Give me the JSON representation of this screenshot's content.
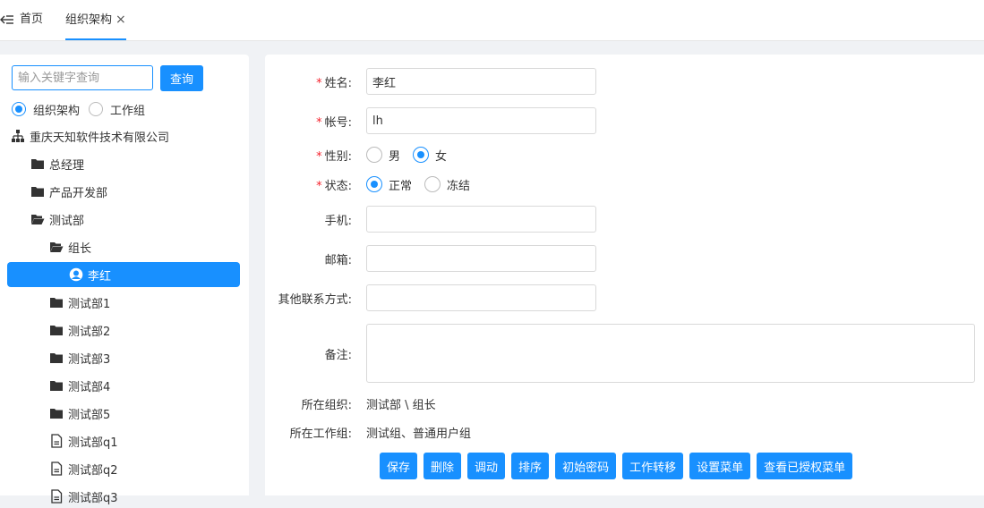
{
  "tabs": {
    "home_label": "首页",
    "org_label": "组织架构",
    "close_glyph": "×"
  },
  "left": {
    "search_placeholder": "输入关键字查询",
    "search_button": "查询",
    "radio_org": "组织架构",
    "radio_workgroup": "工作组",
    "tree": [
      {
        "label": "重庆天知软件技术有限公司",
        "icon": "org-chart-icon"
      },
      {
        "label": "总经理",
        "icon": "folder-icon"
      },
      {
        "label": "产品开发部",
        "icon": "folder-icon"
      },
      {
        "label": "测试部",
        "icon": "folder-open-icon"
      },
      {
        "label": "组长",
        "icon": "folder-open-icon"
      },
      {
        "label": "李红",
        "icon": "user-icon"
      },
      {
        "label": "测试部1",
        "icon": "folder-icon"
      },
      {
        "label": "测试部2",
        "icon": "folder-icon"
      },
      {
        "label": "测试部3",
        "icon": "folder-icon"
      },
      {
        "label": "测试部4",
        "icon": "folder-icon"
      },
      {
        "label": "测试部5",
        "icon": "folder-icon"
      },
      {
        "label": "测试部q1",
        "icon": "file-icon"
      },
      {
        "label": "测试部q2",
        "icon": "file-icon"
      },
      {
        "label": "测试部q3",
        "icon": "file-icon"
      }
    ]
  },
  "form": {
    "name_label": "姓名:",
    "name_value": "李红",
    "account_label": "帐号:",
    "account_value": "lh",
    "gender_label": "性别:",
    "gender_male": "男",
    "gender_female": "女",
    "status_label": "状态:",
    "status_normal": "正常",
    "status_frozen": "冻结",
    "phone_label": "手机:",
    "email_label": "邮箱:",
    "other_contact_label": "其他联系方式:",
    "remark_label": "备注:",
    "org_label": "所在组织:",
    "org_value": "测试部 \\ 组长",
    "workgroup_label": "所在工作组:",
    "workgroup_value": "测试组、普通用户组",
    "required_mark": "*"
  },
  "actions": {
    "save": "保存",
    "delete": "删除",
    "transfer": "调动",
    "sort": "排序",
    "init_password": "初始密码",
    "work_transfer": "工作转移",
    "set_menu": "设置菜单",
    "view_menu": "查看已授权菜单"
  },
  "colors": {
    "accent": "#1890ff",
    "required": "#f5222d"
  }
}
